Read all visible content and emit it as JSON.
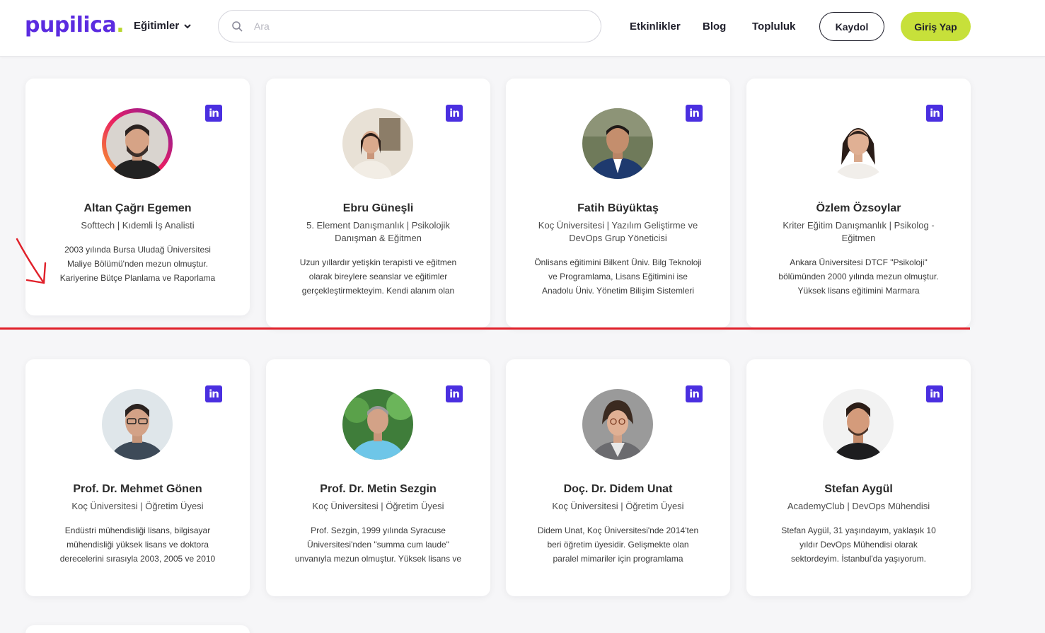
{
  "header": {
    "logo": "pupilica",
    "logo_dot": ".",
    "menu_label": "Eğitimler",
    "search_placeholder": "Ara",
    "nav": [
      "Etkinlikler",
      "Blog",
      "Topluluk"
    ],
    "register_label": "Kaydol",
    "login_label": "Giriş Yap"
  },
  "colors": {
    "brand": "#5b2be0",
    "accent": "#c7e03a",
    "linkedin": "#4a2fe0",
    "annotation": "#e0202a"
  },
  "cards": [
    {
      "name": "Altan Çağrı Egemen",
      "role": "Softtech | Kıdemli İş Analisti",
      "bio": "2003 yılında Bursa Uludağ Üniversitesi Maliye Bölümü'nden mezun olmuştur. Kariyerine Bütçe Planlama ve Raporlama",
      "linkedin_icon": "linkedin-icon"
    },
    {
      "name": "Ebru Güneşli",
      "role": "5. Element Danışmanlık | Psikolojik Danışman & Eğitmen",
      "bio": "Uzun yıllardır yetişkin terapisti ve eğitmen olarak bireylere seanslar ve eğitimler gerçekleştirmekteyim. Kendi alanım olan",
      "linkedin_icon": "linkedin-icon"
    },
    {
      "name": "Fatih Büyüktaş",
      "role": "Koç Üniversitesi | Yazılım Geliştirme ve DevOps Grup Yöneticisi",
      "bio": "Önlisans eğitimini Bilkent Üniv. Bilg Teknoloji ve Programlama, Lisans Eğitimini ise Anadolu Üniv. Yönetim Bilişim Sistemleri",
      "linkedin_icon": "linkedin-icon"
    },
    {
      "name": "Özlem Özsoylar",
      "role": "Kriter Eğitim Danışmanlık | Psikolog - Eğitmen",
      "bio": "Ankara Üniversitesi DTCF \"Psikoloji\" bölümünden 2000 yılında mezun olmuştur. Yüksek lisans eğitimini Marmara Üniversitesi",
      "linkedin_icon": "linkedin-icon"
    },
    {
      "name": "Prof. Dr. Mehmet Gönen",
      "role": "Koç Üniversitesi | Öğretim Üyesi",
      "bio": "Endüstri mühendisliği lisans, bilgisayar mühendisliği yüksek lisans ve doktora derecelerini sırasıyla 2003, 2005 ve 2010",
      "linkedin_icon": "linkedin-icon"
    },
    {
      "name": "Prof. Dr. Metin Sezgin",
      "role": "Koç Üniversitesi | Öğretim Üyesi",
      "bio": "Prof. Sezgin, 1999 yılında Syracuse Üniversitesi'nden \"summa cum laude\" unvanıyla mezun olmuştur. Yüksek lisans ve",
      "linkedin_icon": "linkedin-icon"
    },
    {
      "name": "Doç. Dr. Didem Unat",
      "role": "Koç Üniversitesi | Öğretim Üyesi",
      "bio": "Didem Unat, Koç Üniversitesi'nde 2014'ten beri öğretim üyesidir. Gelişmekte olan paralel mimariler için programlama",
      "linkedin_icon": "linkedin-icon"
    },
    {
      "name": "Stefan Aygül",
      "role": "AcademyClub | DevOps Mühendisi",
      "bio": "Stefan Aygül, 31 yaşındayım, yaklaşık 10 yıldır DevOps Mühendisi olarak sektordeyim. İstanbul'da yaşıyorum.",
      "linkedin_icon": "linkedin-icon"
    }
  ]
}
